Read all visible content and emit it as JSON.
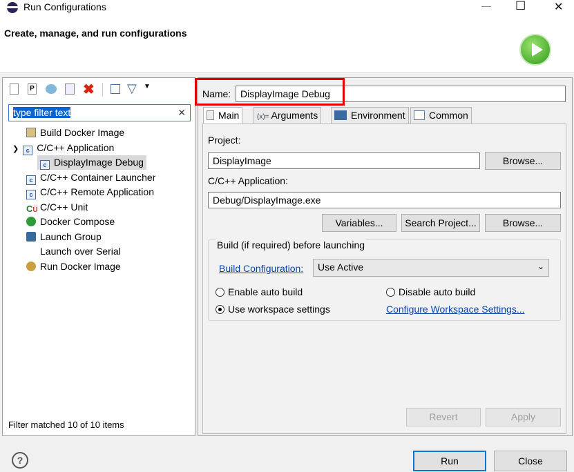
{
  "window": {
    "title": "Run Configurations",
    "minimize": "—",
    "maximize": "☐",
    "close": "✕"
  },
  "header": {
    "title": "Create, manage, and run configurations",
    "run_icon": "green-play-circle-icon"
  },
  "toolbar": {
    "icons": [
      "new-configuration-icon",
      "new-prototype-icon",
      "duplicate-icon",
      "export-icon",
      "delete-icon",
      "collapse-all-icon",
      "filter-icon",
      "dropdown-icon"
    ]
  },
  "filter": {
    "value": "type filter text",
    "clear": "✕"
  },
  "tree": {
    "items": [
      {
        "label": "Build Docker Image",
        "icon": "docker-build-icon"
      },
      {
        "label": "C/C++ Application",
        "icon": "c-app-icon",
        "expanded": true
      },
      {
        "label": "DisplayImage Debug",
        "icon": "c-app-icon",
        "child": true,
        "selected": true
      },
      {
        "label": "C/C++ Container Launcher",
        "icon": "c-app-icon"
      },
      {
        "label": "C/C++ Remote Application",
        "icon": "c-app-icon"
      },
      {
        "label": "C/C++ Unit",
        "icon": "c-unit-icon"
      },
      {
        "label": "Docker Compose",
        "icon": "docker-compose-icon"
      },
      {
        "label": "Launch Group",
        "icon": "launch-group-icon"
      },
      {
        "label": "Launch over Serial",
        "icon": ""
      },
      {
        "label": "Run Docker Image",
        "icon": "docker-run-icon"
      }
    ]
  },
  "status": "Filter matched 10 of 10 items",
  "name": {
    "label": "Name:",
    "value": "DisplayImage Debug",
    "highlight": "#e00000"
  },
  "tabs": [
    {
      "label": "Main",
      "active": true
    },
    {
      "label": "Arguments",
      "prefix": "(x)="
    },
    {
      "label": "Environment"
    },
    {
      "label": "Common"
    }
  ],
  "main": {
    "project_label": "Project:",
    "project_value": "DisplayImage",
    "browse": "Browse...",
    "app_label": "C/C++ Application:",
    "app_value": "Debug/DisplayImage.exe",
    "variables": "Variables...",
    "search_project": "Search Project...",
    "browse2": "Browse...",
    "build_group": "Build (if required) before launching",
    "build_config_link": "Build Configuration:",
    "build_config_value": "Use Active",
    "enable_auto": "Enable auto build",
    "disable_auto": "Disable auto build",
    "use_workspace": "Use workspace settings",
    "configure_link": "Configure Workspace Settings...",
    "selected_radio": "use_workspace"
  },
  "buttons": {
    "revert": "Revert",
    "apply": "Apply",
    "run": "Run",
    "close": "Close",
    "help": "?"
  }
}
